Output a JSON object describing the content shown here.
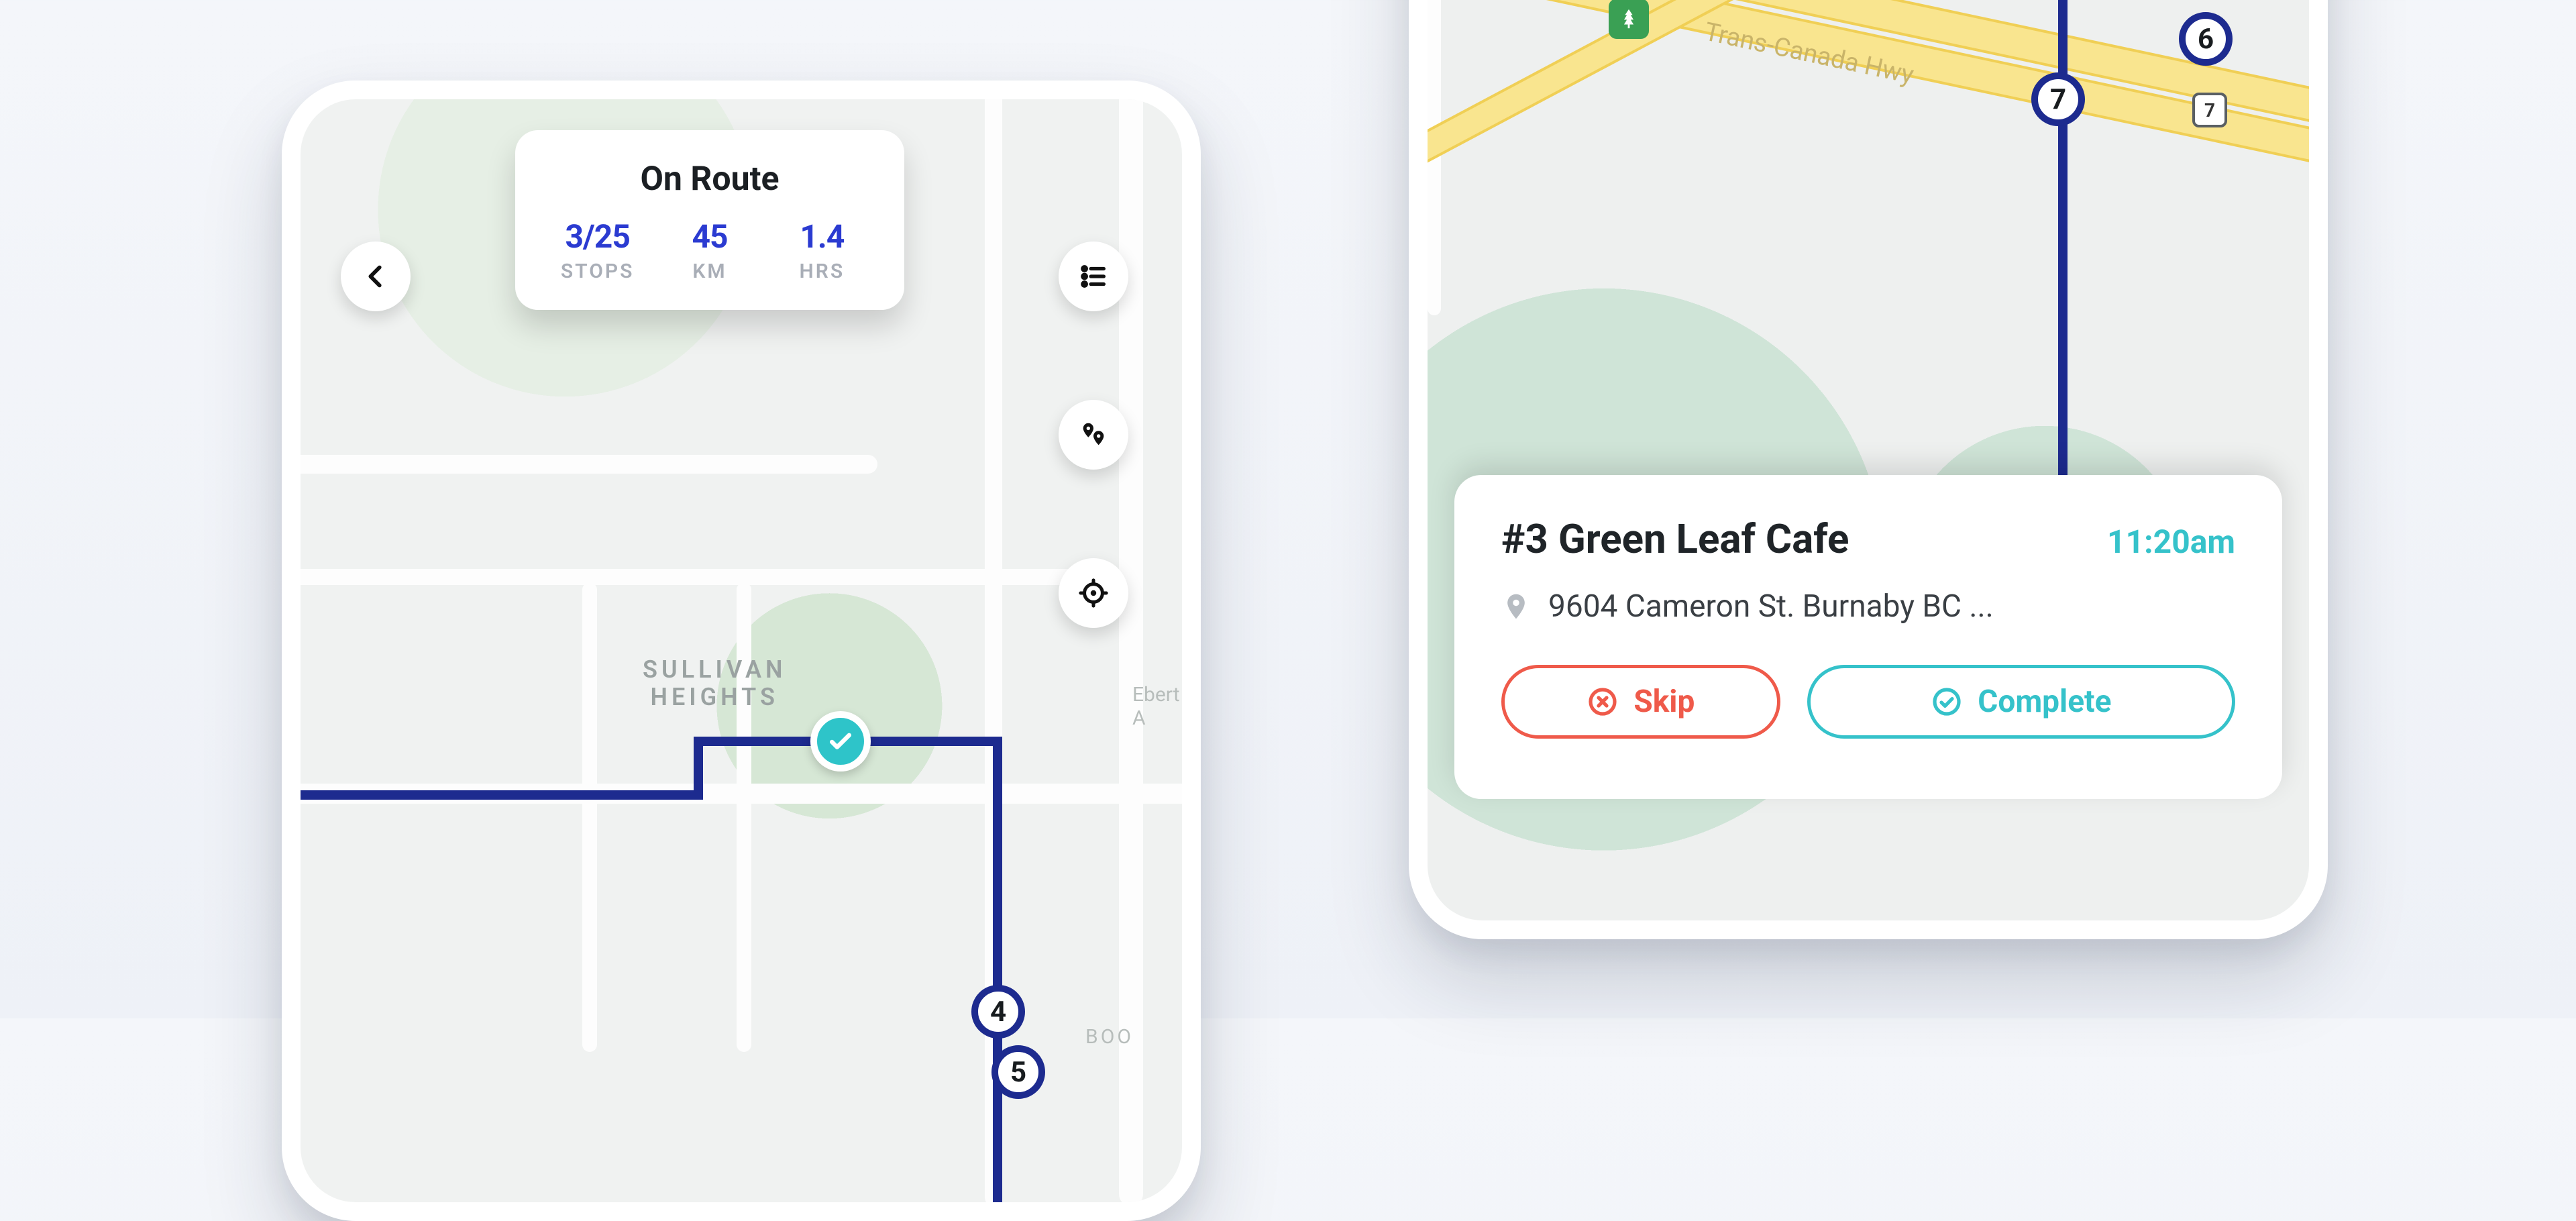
{
  "left": {
    "card": {
      "title": "On Route",
      "stops_value": "3/25",
      "stops_label": "STOPS",
      "km_value": "45",
      "km_label": "KM",
      "hrs_value": "1.4",
      "hrs_label": "HRS"
    },
    "area_line1": "SULLIVAN",
    "area_line2": "HEIGHTS",
    "edge_label": "Ebert A",
    "boo_label": "BOO",
    "stop4": "4",
    "stop5": "5"
  },
  "right": {
    "highway_label": "Trans-Canada Hwy",
    "stop6": "6",
    "stop7": "7",
    "shield7": "7",
    "card": {
      "title": "#3 Green Leaf Cafe",
      "time": "11:20am",
      "address": "9604 Cameron St. Burnaby BC ...",
      "skip_label": "Skip",
      "complete_label": "Complete"
    }
  }
}
